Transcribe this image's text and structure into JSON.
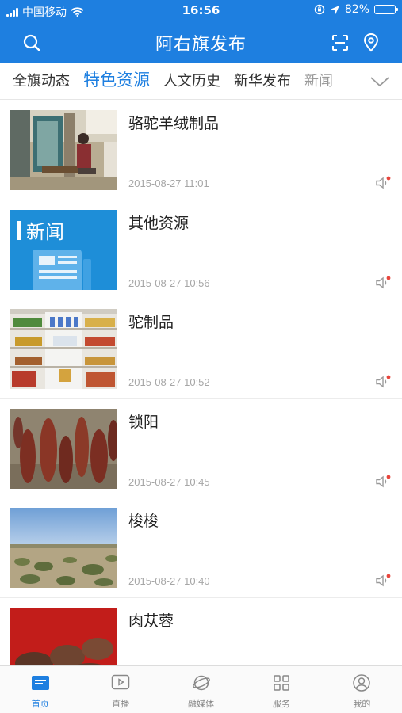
{
  "status_bar": {
    "carrier": "中国移动",
    "time": "16:56",
    "battery": "82%",
    "battery_level": 0.82
  },
  "header": {
    "title": "阿右旗发布",
    "left_icon": "search-icon",
    "right_icons": [
      "scan-icon",
      "location-pin-icon"
    ]
  },
  "tabs": [
    {
      "label": "全旗动态"
    },
    {
      "label": "特色资源",
      "active": true
    },
    {
      "label": "人文历史"
    },
    {
      "label": "新华发布"
    },
    {
      "label": "新闻"
    }
  ],
  "news": [
    {
      "title": "骆驼羊绒制品",
      "date": "2015-08-27 11:01"
    },
    {
      "title": "其他资源",
      "date": "2015-08-27 10:56",
      "thumb_text": "新闻"
    },
    {
      "title": "驼制品",
      "date": "2015-08-27 10:52"
    },
    {
      "title": "锁阳",
      "date": "2015-08-27 10:45"
    },
    {
      "title": "梭梭",
      "date": "2015-08-27 10:40"
    },
    {
      "title": "肉苁蓉",
      "date": ""
    }
  ],
  "bottom_nav": [
    {
      "label": "首页",
      "icon": "home-icon",
      "active": true
    },
    {
      "label": "直播",
      "icon": "live-play-icon"
    },
    {
      "label": "融媒体",
      "icon": "planet-icon"
    },
    {
      "label": "服务",
      "icon": "grid-icon"
    },
    {
      "label": "我的",
      "icon": "user-icon"
    }
  ],
  "colors": {
    "brand_blue": "#1e7fe0",
    "badge_red": "#e8453c",
    "date_gray": "#a6a6a6"
  }
}
